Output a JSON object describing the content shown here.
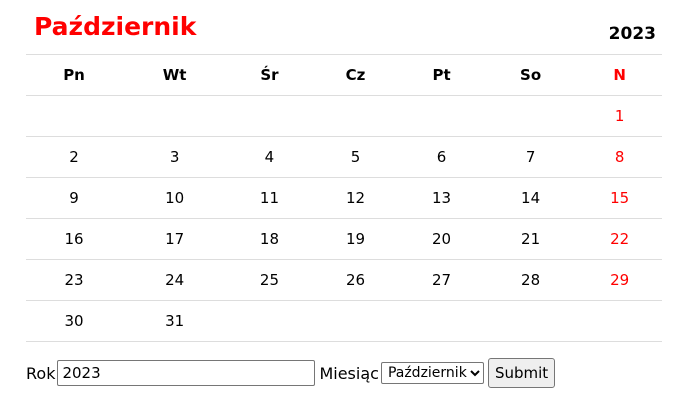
{
  "header": {
    "month": "Październik",
    "year": "2023"
  },
  "weekdays": [
    "Pn",
    "Wt",
    "Śr",
    "Cz",
    "Pt",
    "So",
    "N"
  ],
  "weeks": [
    [
      "",
      "",
      "",
      "",
      "",
      "",
      "1"
    ],
    [
      "2",
      "3",
      "4",
      "5",
      "6",
      "7",
      "8"
    ],
    [
      "9",
      "10",
      "11",
      "12",
      "13",
      "14",
      "15"
    ],
    [
      "16",
      "17",
      "18",
      "19",
      "20",
      "21",
      "22"
    ],
    [
      "23",
      "24",
      "25",
      "26",
      "27",
      "28",
      "29"
    ],
    [
      "30",
      "31",
      "",
      "",
      "",
      "",
      ""
    ]
  ],
  "form": {
    "year_label": "Rok",
    "year_value": "2023",
    "month_label": "Miesiąc",
    "month_selected": "Październik",
    "submit_label": "Submit"
  },
  "colors": {
    "accent": "#ff0000",
    "sunday": "#ff0000",
    "grid": "#dddddd"
  }
}
